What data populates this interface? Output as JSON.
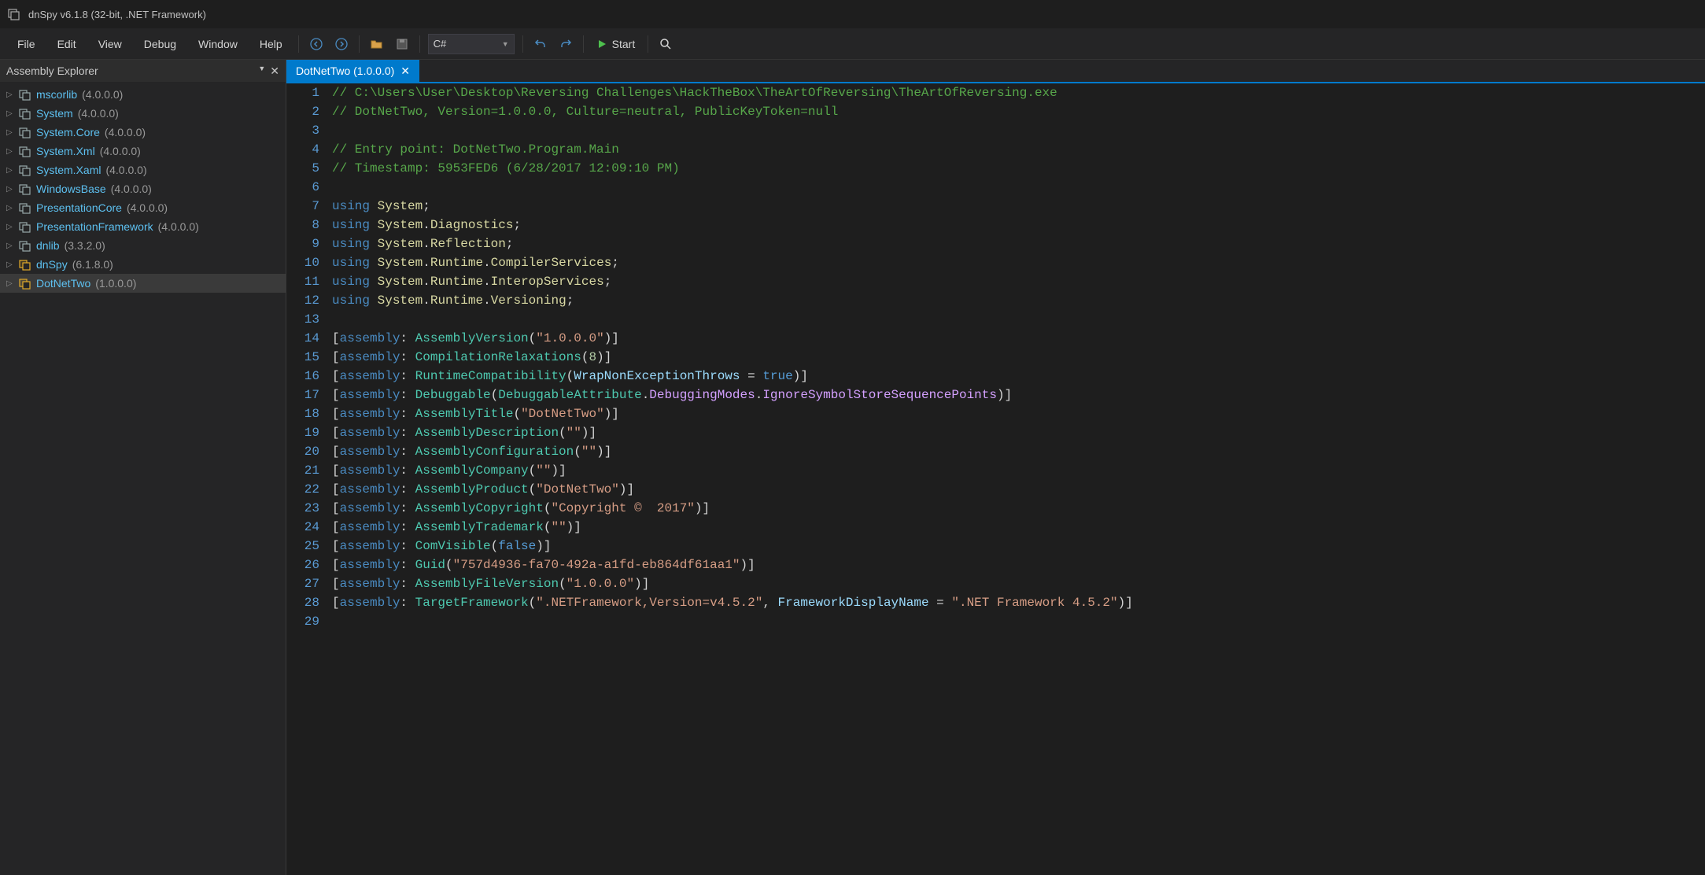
{
  "title": "dnSpy v6.1.8 (32-bit, .NET Framework)",
  "menu": {
    "file": "File",
    "edit": "Edit",
    "view": "View",
    "debug": "Debug",
    "window": "Window",
    "help": "Help"
  },
  "toolbar": {
    "language": "C#",
    "start": "Start"
  },
  "panel": {
    "title": "Assembly Explorer"
  },
  "assemblies": [
    {
      "name": "mscorlib",
      "ver": "(4.0.0.0)",
      "hl": false
    },
    {
      "name": "System",
      "ver": "(4.0.0.0)",
      "hl": false
    },
    {
      "name": "System.Core",
      "ver": "(4.0.0.0)",
      "hl": false
    },
    {
      "name": "System.Xml",
      "ver": "(4.0.0.0)",
      "hl": false
    },
    {
      "name": "System.Xaml",
      "ver": "(4.0.0.0)",
      "hl": false
    },
    {
      "name": "WindowsBase",
      "ver": "(4.0.0.0)",
      "hl": false
    },
    {
      "name": "PresentationCore",
      "ver": "(4.0.0.0)",
      "hl": false
    },
    {
      "name": "PresentationFramework",
      "ver": "(4.0.0.0)",
      "hl": false
    },
    {
      "name": "dnlib",
      "ver": "(3.3.2.0)",
      "hl": false
    },
    {
      "name": "dnSpy",
      "ver": "(6.1.8.0)",
      "hl": true
    },
    {
      "name": "DotNetTwo",
      "ver": "(1.0.0.0)",
      "hl": true,
      "selected": true
    }
  ],
  "tab": {
    "label": "DotNetTwo (1.0.0.0)"
  },
  "code": [
    {
      "n": 1,
      "t": "comment",
      "text": "// C:\\Users\\User\\Desktop\\Reversing Challenges\\HackTheBox\\TheArtOfReversing\\TheArtOfReversing.exe"
    },
    {
      "n": 2,
      "t": "comment",
      "text": "// DotNetTwo, Version=1.0.0.0, Culture=neutral, PublicKeyToken=null"
    },
    {
      "n": 3,
      "t": "blank",
      "text": ""
    },
    {
      "n": 4,
      "t": "comment",
      "text": "// Entry point: DotNetTwo.Program.Main"
    },
    {
      "n": 5,
      "t": "comment",
      "text": "// Timestamp: 5953FED6 (6/28/2017 12:09:10 PM)"
    },
    {
      "n": 6,
      "t": "blank",
      "text": ""
    },
    {
      "n": 7,
      "t": "using",
      "ns": "System"
    },
    {
      "n": 8,
      "t": "using",
      "ns": "System.Diagnostics"
    },
    {
      "n": 9,
      "t": "using",
      "ns": "System.Reflection"
    },
    {
      "n": 10,
      "t": "using",
      "ns": "System.Runtime.CompilerServices"
    },
    {
      "n": 11,
      "t": "using",
      "ns": "System.Runtime.InteropServices"
    },
    {
      "n": 12,
      "t": "using",
      "ns": "System.Runtime.Versioning"
    },
    {
      "n": 13,
      "t": "blank",
      "text": ""
    },
    {
      "n": 14,
      "t": "attr",
      "name": "AssemblyVersion",
      "args": [
        {
          "k": "str",
          "v": "\"1.0.0.0\""
        }
      ]
    },
    {
      "n": 15,
      "t": "attr",
      "name": "CompilationRelaxations",
      "args": [
        {
          "k": "num",
          "v": "8"
        }
      ]
    },
    {
      "n": 16,
      "t": "attr",
      "name": "RuntimeCompatibility",
      "args": [
        {
          "k": "named",
          "p": "WrapNonExceptionThrows",
          "v": "true"
        }
      ]
    },
    {
      "n": 17,
      "t": "attr",
      "name": "Debuggable",
      "args": [
        {
          "k": "enum",
          "owner": "DebuggableAttribute",
          "prop": "DebuggingModes",
          "member": "IgnoreSymbolStoreSequencePoints"
        }
      ]
    },
    {
      "n": 18,
      "t": "attr",
      "name": "AssemblyTitle",
      "args": [
        {
          "k": "str",
          "v": "\"DotNetTwo\""
        }
      ]
    },
    {
      "n": 19,
      "t": "attr",
      "name": "AssemblyDescription",
      "args": [
        {
          "k": "str",
          "v": "\"\""
        }
      ]
    },
    {
      "n": 20,
      "t": "attr",
      "name": "AssemblyConfiguration",
      "args": [
        {
          "k": "str",
          "v": "\"\""
        }
      ]
    },
    {
      "n": 21,
      "t": "attr",
      "name": "AssemblyCompany",
      "args": [
        {
          "k": "str",
          "v": "\"\""
        }
      ]
    },
    {
      "n": 22,
      "t": "attr",
      "name": "AssemblyProduct",
      "args": [
        {
          "k": "str",
          "v": "\"DotNetTwo\""
        }
      ]
    },
    {
      "n": 23,
      "t": "attr",
      "name": "AssemblyCopyright",
      "args": [
        {
          "k": "str",
          "v": "\"Copyright ©  2017\""
        }
      ]
    },
    {
      "n": 24,
      "t": "attr",
      "name": "AssemblyTrademark",
      "args": [
        {
          "k": "str",
          "v": "\"\""
        }
      ]
    },
    {
      "n": 25,
      "t": "attr",
      "name": "ComVisible",
      "args": [
        {
          "k": "kw",
          "v": "false"
        }
      ]
    },
    {
      "n": 26,
      "t": "attr",
      "name": "Guid",
      "args": [
        {
          "k": "str",
          "v": "\"757d4936-fa70-492a-a1fd-eb864df61aa1\""
        }
      ]
    },
    {
      "n": 27,
      "t": "attr",
      "name": "AssemblyFileVersion",
      "args": [
        {
          "k": "str",
          "v": "\"1.0.0.0\""
        }
      ]
    },
    {
      "n": 28,
      "t": "attr",
      "name": "TargetFramework",
      "args": [
        {
          "k": "str",
          "v": "\".NETFramework,Version=v4.5.2\""
        },
        {
          "k": "named",
          "p": "FrameworkDisplayName",
          "vstr": "\".NET Framework 4.5.2\""
        }
      ]
    },
    {
      "n": 29,
      "t": "blank",
      "text": ""
    }
  ]
}
